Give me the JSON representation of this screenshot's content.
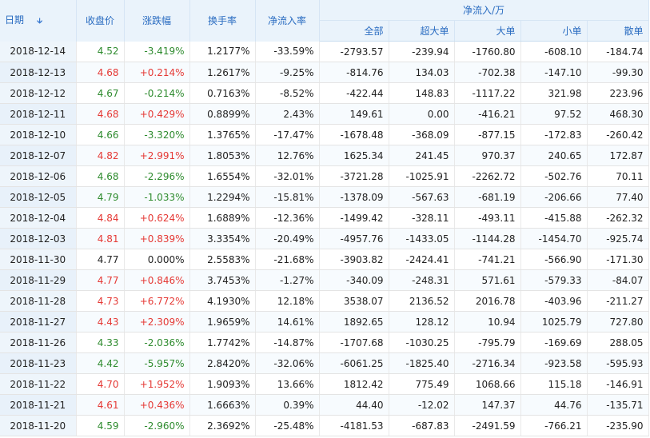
{
  "headers": {
    "date": "日期",
    "close": "收盘价",
    "change": "涨跌幅",
    "turnover": "换手率",
    "net_pct": "净流入率",
    "net_flow_group": "净流入/万",
    "all": "全部",
    "super_large": "超大单",
    "large": "大单",
    "small": "小单",
    "retail": "散单"
  },
  "colors": {
    "up": "#e53935",
    "down": "#2e8b2e",
    "header_text": "#2a6cc1",
    "header_bg": "#eaf3fb"
  },
  "rows": [
    {
      "date": "2018-12-14",
      "close": "4.52",
      "change": "-3.419%",
      "turnover": "1.2177%",
      "net_pct": "-33.59%",
      "all": "-2793.57",
      "super_large": "-239.94",
      "large": "-1760.80",
      "small": "-608.10",
      "retail": "-184.74",
      "dir": "down"
    },
    {
      "date": "2018-12-13",
      "close": "4.68",
      "change": "+0.214%",
      "turnover": "1.2617%",
      "net_pct": "-9.25%",
      "all": "-814.76",
      "super_large": "134.03",
      "large": "-702.38",
      "small": "-147.10",
      "retail": "-99.30",
      "dir": "up"
    },
    {
      "date": "2018-12-12",
      "close": "4.67",
      "change": "-0.214%",
      "turnover": "0.7163%",
      "net_pct": "-8.52%",
      "all": "-422.44",
      "super_large": "148.83",
      "large": "-1117.22",
      "small": "321.98",
      "retail": "223.96",
      "dir": "down"
    },
    {
      "date": "2018-12-11",
      "close": "4.68",
      "change": "+0.429%",
      "turnover": "0.8899%",
      "net_pct": "2.43%",
      "all": "149.61",
      "super_large": "0.00",
      "large": "-416.21",
      "small": "97.52",
      "retail": "468.30",
      "dir": "up"
    },
    {
      "date": "2018-12-10",
      "close": "4.66",
      "change": "-3.320%",
      "turnover": "1.3765%",
      "net_pct": "-17.47%",
      "all": "-1678.48",
      "super_large": "-368.09",
      "large": "-877.15",
      "small": "-172.83",
      "retail": "-260.42",
      "dir": "down"
    },
    {
      "date": "2018-12-07",
      "close": "4.82",
      "change": "+2.991%",
      "turnover": "1.8053%",
      "net_pct": "12.76%",
      "all": "1625.34",
      "super_large": "241.45",
      "large": "970.37",
      "small": "240.65",
      "retail": "172.87",
      "dir": "up"
    },
    {
      "date": "2018-12-06",
      "close": "4.68",
      "change": "-2.296%",
      "turnover": "1.6554%",
      "net_pct": "-32.01%",
      "all": "-3721.28",
      "super_large": "-1025.91",
      "large": "-2262.72",
      "small": "-502.76",
      "retail": "70.11",
      "dir": "down"
    },
    {
      "date": "2018-12-05",
      "close": "4.79",
      "change": "-1.033%",
      "turnover": "1.2294%",
      "net_pct": "-15.81%",
      "all": "-1378.09",
      "super_large": "-567.63",
      "large": "-681.19",
      "small": "-206.66",
      "retail": "77.40",
      "dir": "down"
    },
    {
      "date": "2018-12-04",
      "close": "4.84",
      "change": "+0.624%",
      "turnover": "1.6889%",
      "net_pct": "-12.36%",
      "all": "-1499.42",
      "super_large": "-328.11",
      "large": "-493.11",
      "small": "-415.88",
      "retail": "-262.32",
      "dir": "up"
    },
    {
      "date": "2018-12-03",
      "close": "4.81",
      "change": "+0.839%",
      "turnover": "3.3354%",
      "net_pct": "-20.49%",
      "all": "-4957.76",
      "super_large": "-1433.05",
      "large": "-1144.28",
      "small": "-1454.70",
      "retail": "-925.74",
      "dir": "up"
    },
    {
      "date": "2018-11-30",
      "close": "4.77",
      "change": "0.000%",
      "turnover": "2.5583%",
      "net_pct": "-21.68%",
      "all": "-3903.82",
      "super_large": "-2424.41",
      "large": "-741.21",
      "small": "-566.90",
      "retail": "-171.30",
      "dir": "flat"
    },
    {
      "date": "2018-11-29",
      "close": "4.77",
      "change": "+0.846%",
      "turnover": "3.7453%",
      "net_pct": "-1.27%",
      "all": "-340.09",
      "super_large": "-248.31",
      "large": "571.61",
      "small": "-579.33",
      "retail": "-84.07",
      "dir": "up"
    },
    {
      "date": "2018-11-28",
      "close": "4.73",
      "change": "+6.772%",
      "turnover": "4.1930%",
      "net_pct": "12.18%",
      "all": "3538.07",
      "super_large": "2136.52",
      "large": "2016.78",
      "small": "-403.96",
      "retail": "-211.27",
      "dir": "up"
    },
    {
      "date": "2018-11-27",
      "close": "4.43",
      "change": "+2.309%",
      "turnover": "1.9659%",
      "net_pct": "14.61%",
      "all": "1892.65",
      "super_large": "128.12",
      "large": "10.94",
      "small": "1025.79",
      "retail": "727.80",
      "dir": "up"
    },
    {
      "date": "2018-11-26",
      "close": "4.33",
      "change": "-2.036%",
      "turnover": "1.7742%",
      "net_pct": "-14.87%",
      "all": "-1707.68",
      "super_large": "-1030.25",
      "large": "-795.79",
      "small": "-169.69",
      "retail": "288.05",
      "dir": "down"
    },
    {
      "date": "2018-11-23",
      "close": "4.42",
      "change": "-5.957%",
      "turnover": "2.8420%",
      "net_pct": "-32.06%",
      "all": "-6061.25",
      "super_large": "-1825.40",
      "large": "-2716.34",
      "small": "-923.58",
      "retail": "-595.93",
      "dir": "down"
    },
    {
      "date": "2018-11-22",
      "close": "4.70",
      "change": "+1.952%",
      "turnover": "1.9093%",
      "net_pct": "13.66%",
      "all": "1812.42",
      "super_large": "775.49",
      "large": "1068.66",
      "small": "115.18",
      "retail": "-146.91",
      "dir": "up"
    },
    {
      "date": "2018-11-21",
      "close": "4.61",
      "change": "+0.436%",
      "turnover": "1.6663%",
      "net_pct": "0.39%",
      "all": "44.40",
      "super_large": "-12.02",
      "large": "147.37",
      "small": "44.76",
      "retail": "-135.71",
      "dir": "up"
    },
    {
      "date": "2018-11-20",
      "close": "4.59",
      "change": "-2.960%",
      "turnover": "2.3692%",
      "net_pct": "-25.48%",
      "all": "-4181.53",
      "super_large": "-687.83",
      "large": "-2491.59",
      "small": "-766.21",
      "retail": "-235.90",
      "dir": "down"
    }
  ]
}
